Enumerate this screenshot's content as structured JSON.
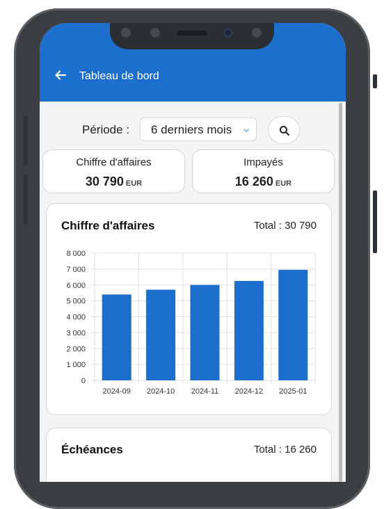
{
  "appbar": {
    "title": "Tableau de bord",
    "back_icon": "arrow-left-icon"
  },
  "filter": {
    "label": "Période :",
    "selected_period": "6 derniers mois",
    "search_icon": "search-icon"
  },
  "kpis": [
    {
      "label": "Chiffre d'affaires",
      "value": "30 790",
      "unit": "EUR"
    },
    {
      "label": "Impayés",
      "value": "16 260",
      "unit": "EUR"
    }
  ],
  "revenue_card": {
    "title": "Chiffre d'affaires",
    "total": "Total : 30 790"
  },
  "echeances_card": {
    "title": "Échéances",
    "total": "Total : 16 260"
  },
  "colors": {
    "accent": "#1c6fcc",
    "bar": "#1c6fcc"
  },
  "chart_data": {
    "type": "bar",
    "categories": [
      "2024-09",
      "2024-10",
      "2024-11",
      "2024-12",
      "2025-01"
    ],
    "values": [
      5400,
      5700,
      6000,
      6250,
      6950
    ],
    "ylim": [
      0,
      8000
    ],
    "yticks": [
      0,
      1000,
      2000,
      3000,
      4000,
      5000,
      6000,
      7000,
      8000
    ],
    "ytick_labels": [
      "0",
      "1 000",
      "2 000",
      "3 000",
      "4 000",
      "5 000",
      "6 000",
      "7 000",
      "8 000"
    ],
    "grid": true,
    "title": "Chiffre d'affaires",
    "xlabel": "",
    "ylabel": ""
  }
}
